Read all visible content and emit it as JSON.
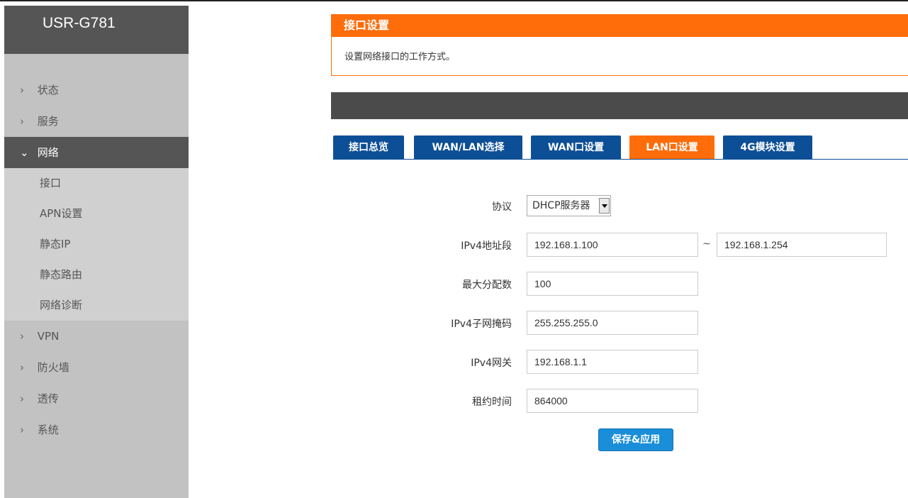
{
  "brand": "USR-G781",
  "sidebar": {
    "items": [
      {
        "label": "状态"
      },
      {
        "label": "服务"
      },
      {
        "label": "网络"
      },
      {
        "label": "VPN"
      },
      {
        "label": "防火墙"
      },
      {
        "label": "透传"
      },
      {
        "label": "系统"
      }
    ],
    "network_sub": [
      {
        "label": "接口"
      },
      {
        "label": "APN设置"
      },
      {
        "label": "静态IP"
      },
      {
        "label": "静态路由"
      },
      {
        "label": "网络诊断"
      }
    ]
  },
  "panel": {
    "title": "接口设置",
    "description": "设置网络接口的工作方式。"
  },
  "tabs": [
    {
      "label": "接口总览"
    },
    {
      "label": "WAN/LAN选择"
    },
    {
      "label": "WAN口设置"
    },
    {
      "label": "LAN口设置",
      "active": true
    },
    {
      "label": "4G模块设置"
    }
  ],
  "form": {
    "protocol_label": "协议",
    "protocol_value": "DHCP服务器",
    "ipv4_range_label": "IPv4地址段",
    "ipv4_range_start": "192.168.1.100",
    "range_separator": "~",
    "ipv4_range_end": "192.168.1.254",
    "max_alloc_label": "最大分配数",
    "max_alloc_value": "100",
    "netmask_label": "IPv4子网掩码",
    "netmask_value": "255.255.255.0",
    "gateway_label": "IPv4网关",
    "gateway_value": "192.168.1.1",
    "lease_label": "租约时间",
    "lease_value": "864000",
    "save_label": "保存&应用"
  },
  "colors": {
    "accent_orange": "#ff6c0a",
    "tab_blue": "#0d4f96",
    "button_blue": "#1a8ed8",
    "sidebar_dark": "#555555"
  }
}
